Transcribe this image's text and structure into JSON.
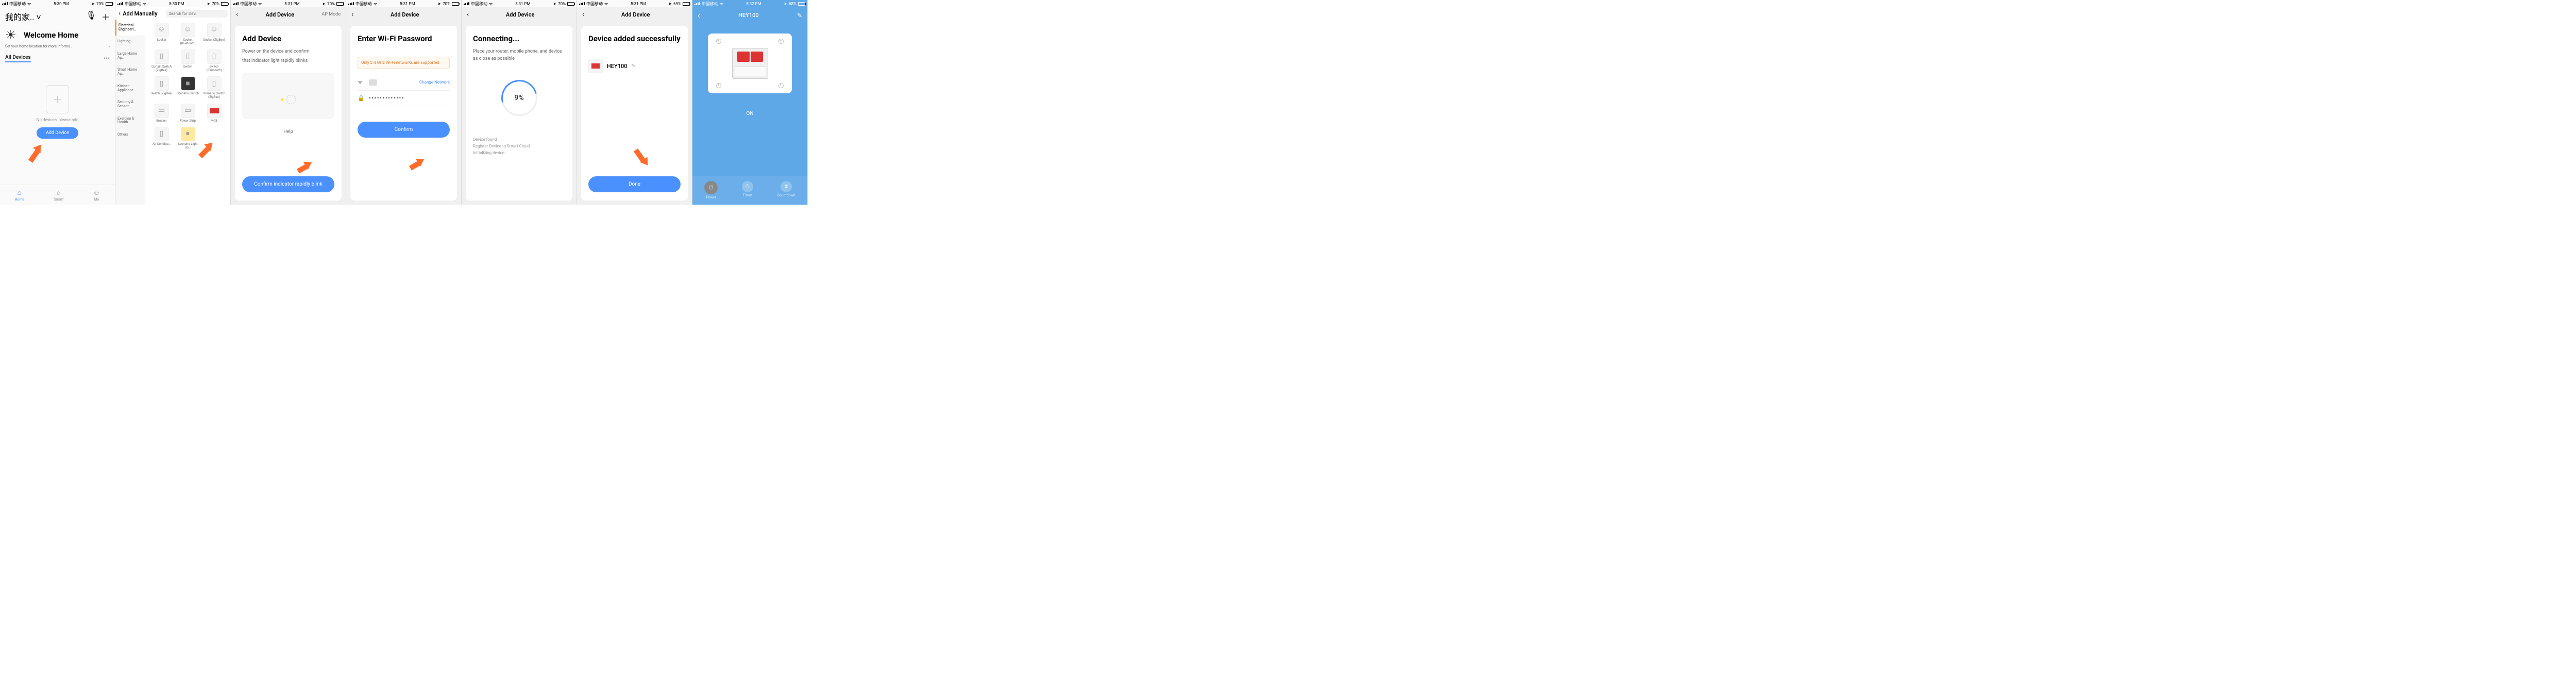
{
  "status_bar": {
    "carrier": "中国移动",
    "times": [
      "5:30 PM",
      "5:30 PM",
      "5:31 PM",
      "5:31 PM",
      "5:31 PM",
      "5:31 PM",
      "5:32 PM"
    ],
    "batt": [
      "70%",
      "70%",
      "70%",
      "70%",
      "70%",
      "69%",
      "68%"
    ],
    "loc_icon": "✈"
  },
  "s1": {
    "location": "我的家.. ˅",
    "mic": "🎤",
    "plus": "＋",
    "welcome": "Welcome Home",
    "sub": "Set your home location for more informa…",
    "sub_arrow": "›",
    "tab": "All Devices",
    "dots": "•••",
    "nodev_plus": "＋",
    "nodev_text": "No devices, please add",
    "add_btn": "Add Device",
    "tabs": {
      "home": "Home",
      "smart": "Smart",
      "me": "Me"
    },
    "icons": {
      "home": "⌂",
      "smart": "☼",
      "me": "☺"
    }
  },
  "s2": {
    "title": "Add Manually",
    "search_ph": "Search for Devi",
    "scan": "[ ]",
    "categories": [
      "Electrical Engineeri…",
      "Lighting",
      "Large Home Ap…",
      "Small Home Ap…",
      "Kitchen Appliance",
      "Security & Sensor",
      "Exercise & Health",
      "Others"
    ],
    "grid": [
      [
        "Socket",
        "Socket (Bluetooth)",
        "Socket (ZigBee)"
      ],
      [
        "Curtain Switch (ZigBee)",
        "Switch",
        "Switch (Bluetooth)"
      ],
      [
        "Switch (ZigBee)",
        "Scenario Switch",
        "Scenario Switch (ZigBee)"
      ],
      [
        "Breaker",
        "Power Strip",
        "MCB"
      ],
      [
        "Air Conditio…",
        "Scenario Light So…",
        ""
      ]
    ]
  },
  "s3": {
    "nav_title": "Add Device",
    "nav_right": "AP Mode",
    "h1": "Add Device",
    "p1": "Power on the device and confirm",
    "p2": "that indicator light rapidly blinks",
    "help": "Help",
    "btn": "Confirm indicator rapidly blink"
  },
  "s4": {
    "nav_title": "Add Device",
    "h1": "Enter Wi-Fi Password",
    "warn": "Only 2.4 GHz Wi-Fi networks are supported",
    "change": "Change Network",
    "wifi_icon": "ᯤ",
    "lock_icon": "🔒",
    "pw": "•••••••••••••",
    "btn": "Confirm"
  },
  "s5": {
    "nav_title": "Add Device",
    "h1": "Connecting...",
    "p1": "Place your router, mobile phone, and device as close as possible",
    "pct": "9%",
    "status": [
      "Device found",
      "Register Device to Smart Cloud",
      "Initializing device…"
    ]
  },
  "s6": {
    "nav_title": "Add Device",
    "h1": "Device added successfully",
    "dev_name": "HEY100",
    "edit": "✎",
    "btn": "Done"
  },
  "s7": {
    "title": "HEY100",
    "back": "‹",
    "edit": "✎",
    "state": "ON",
    "bottom": {
      "power": "Power",
      "timer": "Timer",
      "countdown": "Countdown"
    },
    "icons": {
      "power": "⏻",
      "timer": "⏱",
      "countdown": "⧗"
    }
  }
}
